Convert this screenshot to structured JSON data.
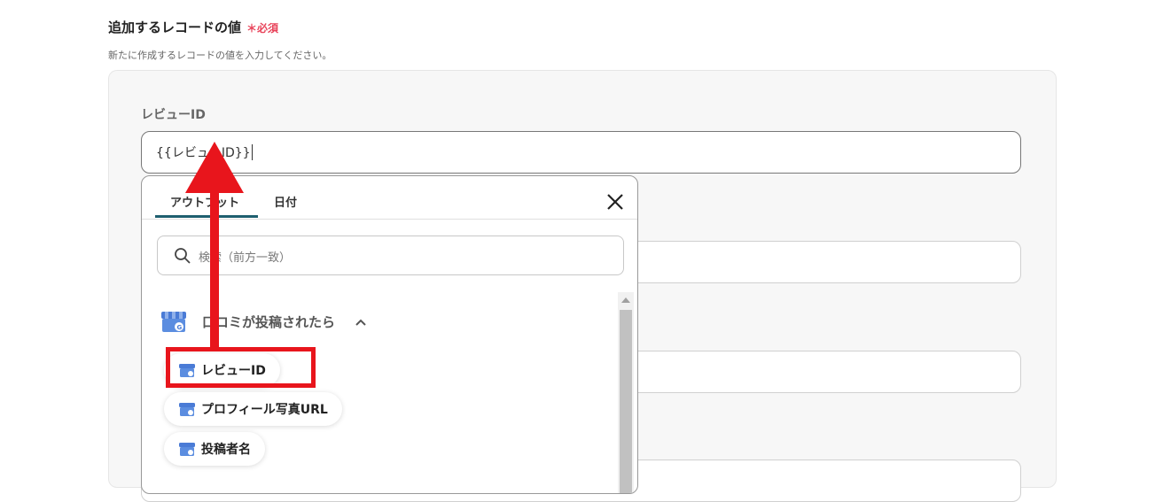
{
  "section": {
    "title": "追加するレコードの値",
    "required": "＊必須",
    "description": "新たに作成するレコードの値を入力してください。"
  },
  "field": {
    "label": "レビューID",
    "value": "{{レビューID}}"
  },
  "dropdown": {
    "tabs": [
      {
        "label": "アウトプット",
        "active": true
      },
      {
        "label": "日付",
        "active": false
      }
    ],
    "search_placeholder": "検索（前方一致）",
    "group": {
      "label": "口コミが投稿されたら",
      "icon": "google-business-profile-icon",
      "expanded": true
    },
    "items": [
      {
        "label": "レビューID",
        "highlighted": true
      },
      {
        "label": "プロフィール写真URL",
        "highlighted": false
      },
      {
        "label": "投稿者名",
        "highlighted": false
      }
    ]
  },
  "colors": {
    "accent_tab": "#1e5f6f",
    "required": "#e8435a",
    "annotation": "#e8151c"
  }
}
